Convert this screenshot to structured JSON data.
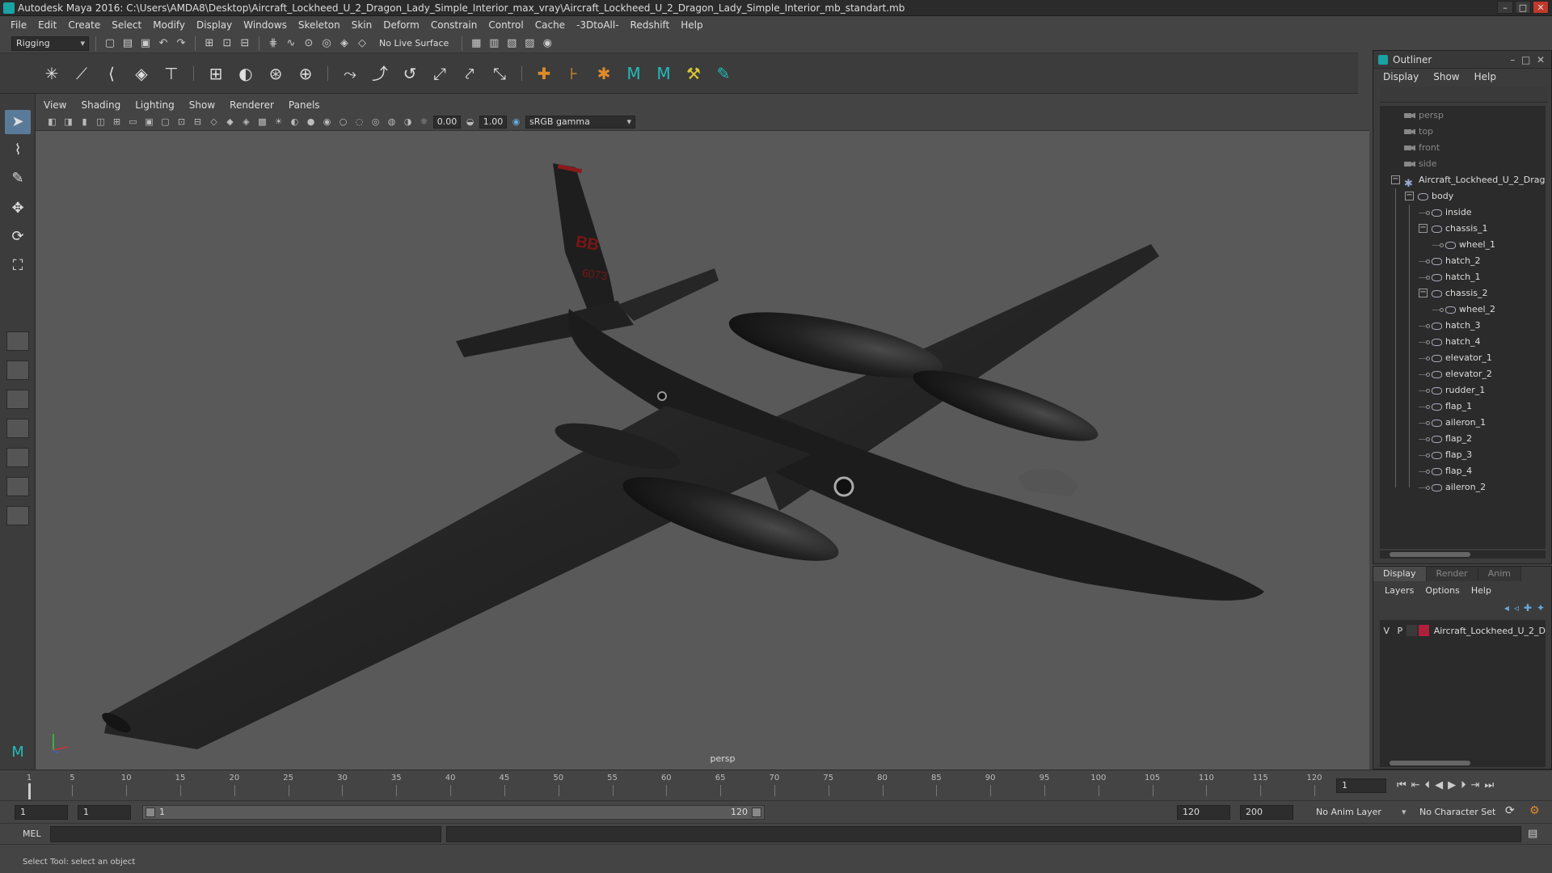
{
  "window": {
    "title": "Autodesk Maya 2016: C:\\Users\\AMDA8\\Desktop\\Aircraft_Lockheed_U_2_Dragon_Lady_Simple_Interior_max_vray\\Aircraft_Lockheed_U_2_Dragon_Lady_Simple_Interior_mb_standart.mb"
  },
  "menubar": [
    "File",
    "Edit",
    "Create",
    "Select",
    "Modify",
    "Display",
    "Windows",
    "Skeleton",
    "Skin",
    "Deform",
    "Constrain",
    "Control",
    "Cache",
    "-3DtoAll-",
    "Redshift",
    "Help"
  ],
  "statusline": {
    "mode": "Rigging",
    "live_surface": "No Live Surface"
  },
  "panel": {
    "menu": [
      "View",
      "Shading",
      "Lighting",
      "Show",
      "Renderer",
      "Panels"
    ],
    "exposure": "0.00",
    "gamma_value": "1.00",
    "color_space": "sRGB gamma",
    "camera_label": "persp"
  },
  "outliner": {
    "title": "Outliner",
    "menu": [
      "Display",
      "Show",
      "Help"
    ],
    "items": [
      {
        "label": "persp",
        "type": "camera",
        "depth": 0
      },
      {
        "label": "top",
        "type": "camera",
        "depth": 0
      },
      {
        "label": "front",
        "type": "camera",
        "depth": 0
      },
      {
        "label": "side",
        "type": "camera",
        "depth": 0
      },
      {
        "label": "Aircraft_Lockheed_U_2_Drag",
        "type": "group",
        "depth": 0
      },
      {
        "label": "body",
        "type": "mesh",
        "depth": 1
      },
      {
        "label": "inside",
        "type": "mesh",
        "depth": 2
      },
      {
        "label": "chassis_1",
        "type": "mesh",
        "depth": 2
      },
      {
        "label": "wheel_1",
        "type": "mesh",
        "depth": 3
      },
      {
        "label": "hatch_2",
        "type": "mesh",
        "depth": 2
      },
      {
        "label": "hatch_1",
        "type": "mesh",
        "depth": 2
      },
      {
        "label": "chassis_2",
        "type": "mesh",
        "depth": 2
      },
      {
        "label": "wheel_2",
        "type": "mesh",
        "depth": 3
      },
      {
        "label": "hatch_3",
        "type": "mesh",
        "depth": 2
      },
      {
        "label": "hatch_4",
        "type": "mesh",
        "depth": 2
      },
      {
        "label": "elevator_1",
        "type": "mesh",
        "depth": 2
      },
      {
        "label": "elevator_2",
        "type": "mesh",
        "depth": 2
      },
      {
        "label": "rudder_1",
        "type": "mesh",
        "depth": 2
      },
      {
        "label": "flap_1",
        "type": "mesh",
        "depth": 2
      },
      {
        "label": "aileron_1",
        "type": "mesh",
        "depth": 2
      },
      {
        "label": "flap_2",
        "type": "mesh",
        "depth": 2
      },
      {
        "label": "flap_3",
        "type": "mesh",
        "depth": 2
      },
      {
        "label": "flap_4",
        "type": "mesh",
        "depth": 2
      },
      {
        "label": "aileron_2",
        "type": "mesh",
        "depth": 2
      }
    ]
  },
  "layers": {
    "tabs": [
      "Display",
      "Render",
      "Anim"
    ],
    "menu": [
      "Layers",
      "Options",
      "Help"
    ],
    "row": {
      "v": "V",
      "p": "P",
      "name": "Aircraft_Lockheed_U_2_D",
      "color": "#b0203a"
    }
  },
  "timeline": {
    "ticks": [
      "1",
      "5",
      "10",
      "15",
      "20",
      "25",
      "30",
      "35",
      "40",
      "45",
      "50",
      "55",
      "60",
      "65",
      "70",
      "75",
      "80",
      "85",
      "90",
      "95",
      "100",
      "105",
      "110",
      "115",
      "120"
    ],
    "current_frame": "1"
  },
  "range": {
    "start": "1",
    "playback_start": "1",
    "bar_start": "1",
    "bar_end": "120",
    "playback_end": "120",
    "end": "200",
    "anim_layer": "No Anim Layer",
    "character_set": "No Character Set"
  },
  "cmdline": {
    "label": "MEL"
  },
  "helpline": {
    "text": "Select Tool: select an object"
  },
  "aircraft_markings": {
    "tail_code": "BB",
    "serial": "6073"
  }
}
